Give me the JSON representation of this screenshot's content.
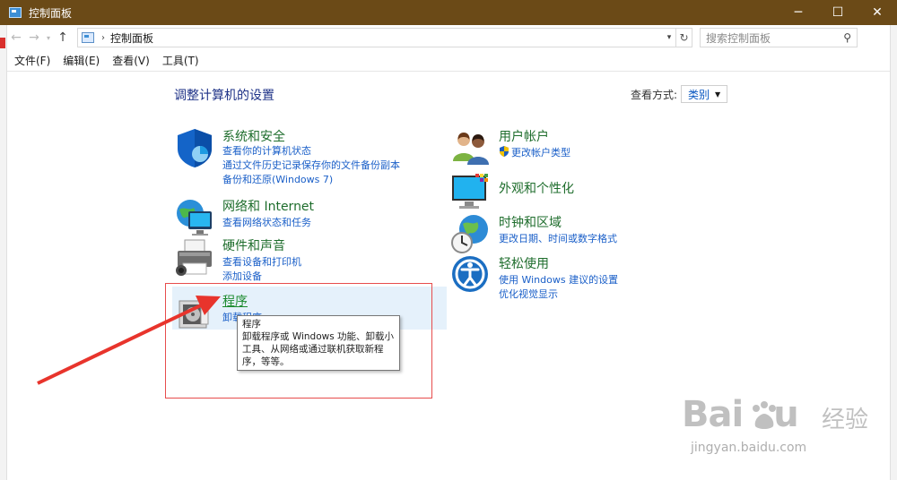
{
  "window": {
    "title": "控制面板",
    "controls": {
      "minimize": "─",
      "maximize": "☐",
      "close": "✕"
    }
  },
  "address": {
    "breadcrumb": "控制面板",
    "search_placeholder": "搜索控制面板"
  },
  "menu": {
    "items": [
      "文件(F)",
      "编辑(E)",
      "查看(V)",
      "工具(T)"
    ]
  },
  "main": {
    "heading": "调整计算机的设置",
    "view_by_label": "查看方式:",
    "view_by_value": "类别"
  },
  "categories": {
    "system": {
      "title": "系统和安全",
      "links": [
        "查看你的计算机状态",
        "通过文件历史记录保存你的文件备份副本",
        "备份和还原(Windows 7)"
      ]
    },
    "network": {
      "title": "网络和 Internet",
      "links": [
        "查看网络状态和任务"
      ]
    },
    "hardware": {
      "title": "硬件和声音",
      "links": [
        "查看设备和打印机",
        "添加设备"
      ]
    },
    "programs": {
      "title": "程序",
      "links": [
        "卸载程序"
      ]
    },
    "user": {
      "title": "用户帐户",
      "links": [
        "更改帐户类型"
      ]
    },
    "appearance": {
      "title": "外观和个性化",
      "links": []
    },
    "clock": {
      "title": "时钟和区域",
      "links": [
        "更改日期、时间或数字格式"
      ]
    },
    "ease": {
      "title": "轻松使用",
      "links": [
        "使用 Windows 建议的设置",
        "优化视觉显示"
      ]
    }
  },
  "tooltip": {
    "title": "程序",
    "body": "卸载程序或 Windows 功能、卸载小工具、从网络或通过联机获取新程序，等等。"
  },
  "colors": {
    "titlebar": "#6b4a17",
    "heading": "#1e3287",
    "category_title": "#1e6d2c",
    "link": "#1a5fc8",
    "annotation": "#e74c4c"
  }
}
